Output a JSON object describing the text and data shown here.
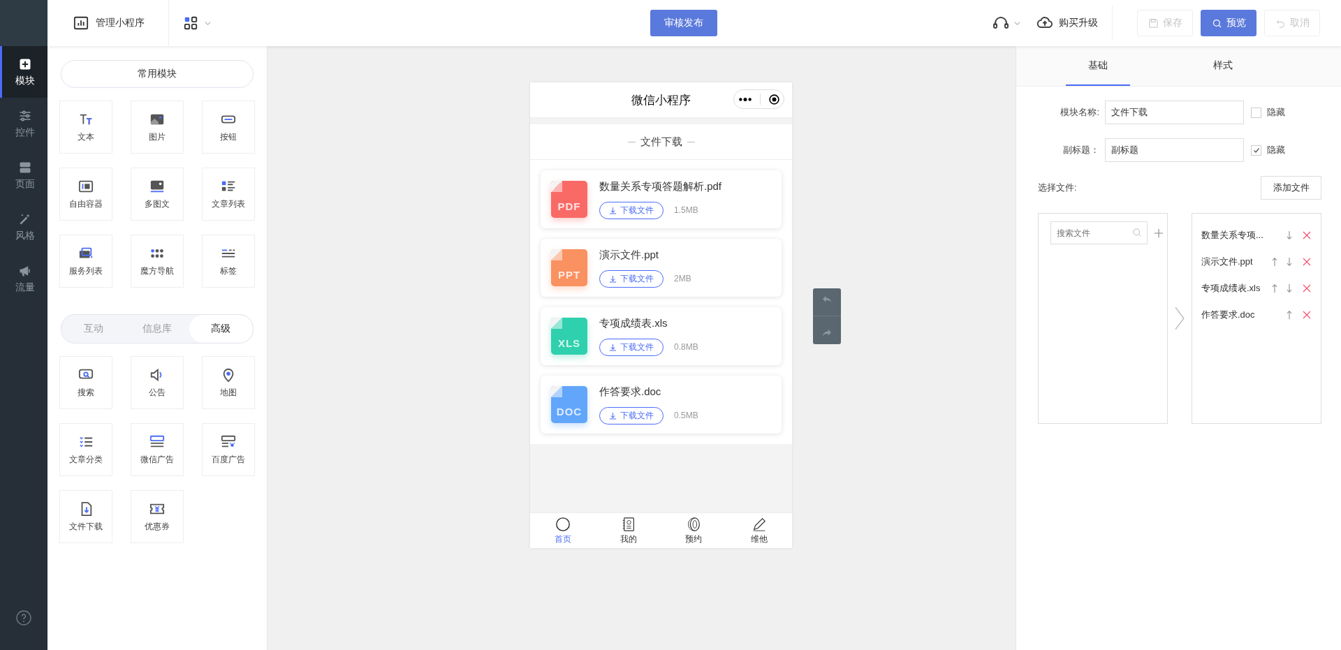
{
  "topbar": {
    "manage_label": "管理小程序",
    "publish_button": "审核发布",
    "upgrade_label": "购买升级",
    "save_button": {
      "label": "保存",
      "disabled": true
    },
    "preview_button": "预览",
    "cancel_button": {
      "label": "取消",
      "disabled": true
    }
  },
  "nav": {
    "items": [
      {
        "label": "模块",
        "selected": true
      },
      {
        "label": "控件",
        "selected": false
      },
      {
        "label": "页面",
        "selected": false
      },
      {
        "label": "风格",
        "selected": false
      },
      {
        "label": "流量",
        "selected": false
      }
    ]
  },
  "modules": {
    "common_button": "常用模块",
    "common_items": [
      "文本",
      "图片",
      "按钮",
      "自由容器",
      "多图文",
      "文章列表",
      "服务列表",
      "魔方导航",
      "标签"
    ],
    "category_tabs": [
      {
        "label": "互动",
        "selected": false
      },
      {
        "label": "信息库",
        "selected": false
      },
      {
        "label": "高级",
        "selected": true
      }
    ],
    "advanced_items": [
      "搜索",
      "公告",
      "地图",
      "文章分类",
      "微信广告",
      "百度广告",
      "文件下载",
      "优惠券"
    ]
  },
  "phone": {
    "title": "微信小程序",
    "section_title": "文件下载",
    "files": [
      {
        "name": "数量关系专项答题解析.pdf",
        "badge": "PDF",
        "color": "#f96a66",
        "button": "下载文件",
        "size": "1.5MB"
      },
      {
        "name": "演示文件.ppt",
        "badge": "PPT",
        "color": "#fa9160",
        "button": "下载文件",
        "size": "2MB"
      },
      {
        "name": "专项成绩表.xls",
        "badge": "XLS",
        "color": "#2fd0ad",
        "button": "下载文件",
        "size": "0.8MB"
      },
      {
        "name": "作答要求.doc",
        "badge": "DOC",
        "color": "#62a6fb",
        "button": "下载文件",
        "size": "0.5MB"
      }
    ],
    "tabbar": [
      {
        "label": "首页",
        "selected": true
      },
      {
        "label": "我的",
        "selected": false
      },
      {
        "label": "预约",
        "selected": false
      },
      {
        "label": "维他",
        "selected": false
      }
    ]
  },
  "settings": {
    "tabs": [
      {
        "label": "基础",
        "selected": true
      },
      {
        "label": "样式",
        "selected": false
      }
    ],
    "fields": [
      {
        "label": "模块名称:",
        "value": "文件下载",
        "hidden": false,
        "hide_label": "隐藏"
      },
      {
        "label": "副标题：",
        "value": "副标题",
        "hidden": true,
        "hide_label": "隐藏"
      }
    ],
    "select_label": "选择文件:",
    "add_button": "添加文件",
    "search": {
      "placeholder": "搜索文件"
    },
    "selected_files": [
      {
        "name": "数量关系专项...",
        "can_move_up": false,
        "can_move_down": true
      },
      {
        "name": "演示文件.ppt",
        "can_move_up": true,
        "can_move_down": true
      },
      {
        "name": "专项成绩表.xls",
        "can_move_up": true,
        "can_move_down": true
      },
      {
        "name": "作答要求.doc",
        "can_move_up": true,
        "can_move_down": false
      }
    ]
  }
}
